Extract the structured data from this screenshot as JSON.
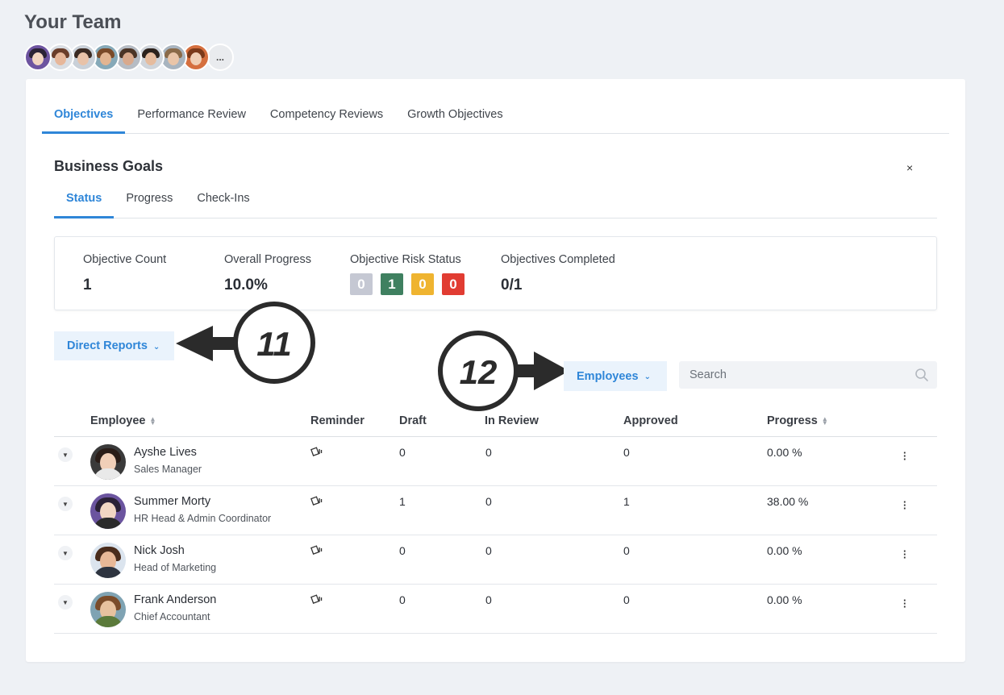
{
  "page": {
    "title": "Your Team",
    "more_label": "..."
  },
  "team_avatars": [
    {
      "name": "avatar-1",
      "bg": "#6d54a0",
      "face": "#f1d4c0",
      "hair": "#2a2235"
    },
    {
      "name": "avatar-2",
      "bg": "#d9dde2",
      "face": "#e7b79a",
      "hair": "#6a3d2a"
    },
    {
      "name": "avatar-3",
      "bg": "#c9d0d8",
      "face": "#e8c2a8",
      "hair": "#3a2a22"
    },
    {
      "name": "avatar-4",
      "bg": "#86a9b8",
      "face": "#e2b591",
      "hair": "#7a4a28"
    },
    {
      "name": "avatar-5",
      "bg": "#b6bcc4",
      "face": "#d9a98c",
      "hair": "#4b3426"
    },
    {
      "name": "avatar-6",
      "bg": "#cfd4da",
      "face": "#e6bc9e",
      "hair": "#2c221c"
    },
    {
      "name": "avatar-7",
      "bg": "#a8b4bf",
      "face": "#e9c5a8",
      "hair": "#8a6a48"
    },
    {
      "name": "avatar-8",
      "bg": "#d56f3e",
      "face": "#f0cfb5",
      "hair": "#7b3a1a"
    }
  ],
  "main_tabs": [
    {
      "label": "Objectives",
      "active": true
    },
    {
      "label": "Performance Review",
      "active": false
    },
    {
      "label": "Competency Reviews",
      "active": false
    },
    {
      "label": "Growth Objectives",
      "active": false
    }
  ],
  "section": {
    "title": "Business Goals",
    "close_label": "×"
  },
  "sub_tabs": [
    {
      "label": "Status",
      "active": true
    },
    {
      "label": "Progress",
      "active": false
    },
    {
      "label": "Check-Ins",
      "active": false
    }
  ],
  "stats": {
    "objective_count_label": "Objective Count",
    "objective_count": "1",
    "overall_progress_label": "Overall Progress",
    "overall_progress": "10.0%",
    "risk_label": "Objective Risk Status",
    "risk": [
      {
        "value": "0",
        "color": "#c5c8d3"
      },
      {
        "value": "1",
        "color": "#3f8060"
      },
      {
        "value": "0",
        "color": "#efb430"
      },
      {
        "value": "0",
        "color": "#e13c32"
      }
    ],
    "completed_label": "Objectives Completed",
    "completed": "0/1"
  },
  "filters": {
    "direct_reports_label": "Direct Reports",
    "employees_label": "Employees",
    "chevron": "⌄",
    "search_placeholder": "Search"
  },
  "callouts": {
    "first": "11",
    "second": "12"
  },
  "table": {
    "headers": {
      "employee": "Employee",
      "reminder": "Reminder",
      "draft": "Draft",
      "in_review": "In Review",
      "approved": "Approved",
      "progress": "Progress"
    },
    "rows": [
      {
        "name": "Ayshe Lives",
        "title": "Sales Manager",
        "draft": "0",
        "in_review": "0",
        "approved": "0",
        "progress": "0.00 %",
        "bg": "#3a3a3a",
        "face": "#f1cfb8",
        "hair": "#2a1d18",
        "body": "#e9e9e9"
      },
      {
        "name": "Summer Morty",
        "title": "HR Head & Admin Coordinator",
        "draft": "1",
        "in_review": "0",
        "approved": "1",
        "progress": "38.00 %",
        "bg": "#6b549f",
        "face": "#f2d6c4",
        "hair": "#2b2136",
        "body": "#2b2b2b"
      },
      {
        "name": "Nick Josh",
        "title": "Head of Marketing",
        "draft": "0",
        "in_review": "0",
        "approved": "0",
        "progress": "0.00 %",
        "bg": "#dbe4ee",
        "face": "#e8b897",
        "hair": "#4a2c1c",
        "body": "#2e3440"
      },
      {
        "name": "Frank Anderson",
        "title": "Chief Accountant",
        "draft": "0",
        "in_review": "0",
        "approved": "0",
        "progress": "0.00 %",
        "bg": "#7fa3b3",
        "face": "#e7c29f",
        "hair": "#7a4c2a",
        "body": "#5b7a3a"
      }
    ]
  },
  "colors": {
    "accent": "#2f86d8",
    "accent_bg": "#eaf3fc"
  }
}
